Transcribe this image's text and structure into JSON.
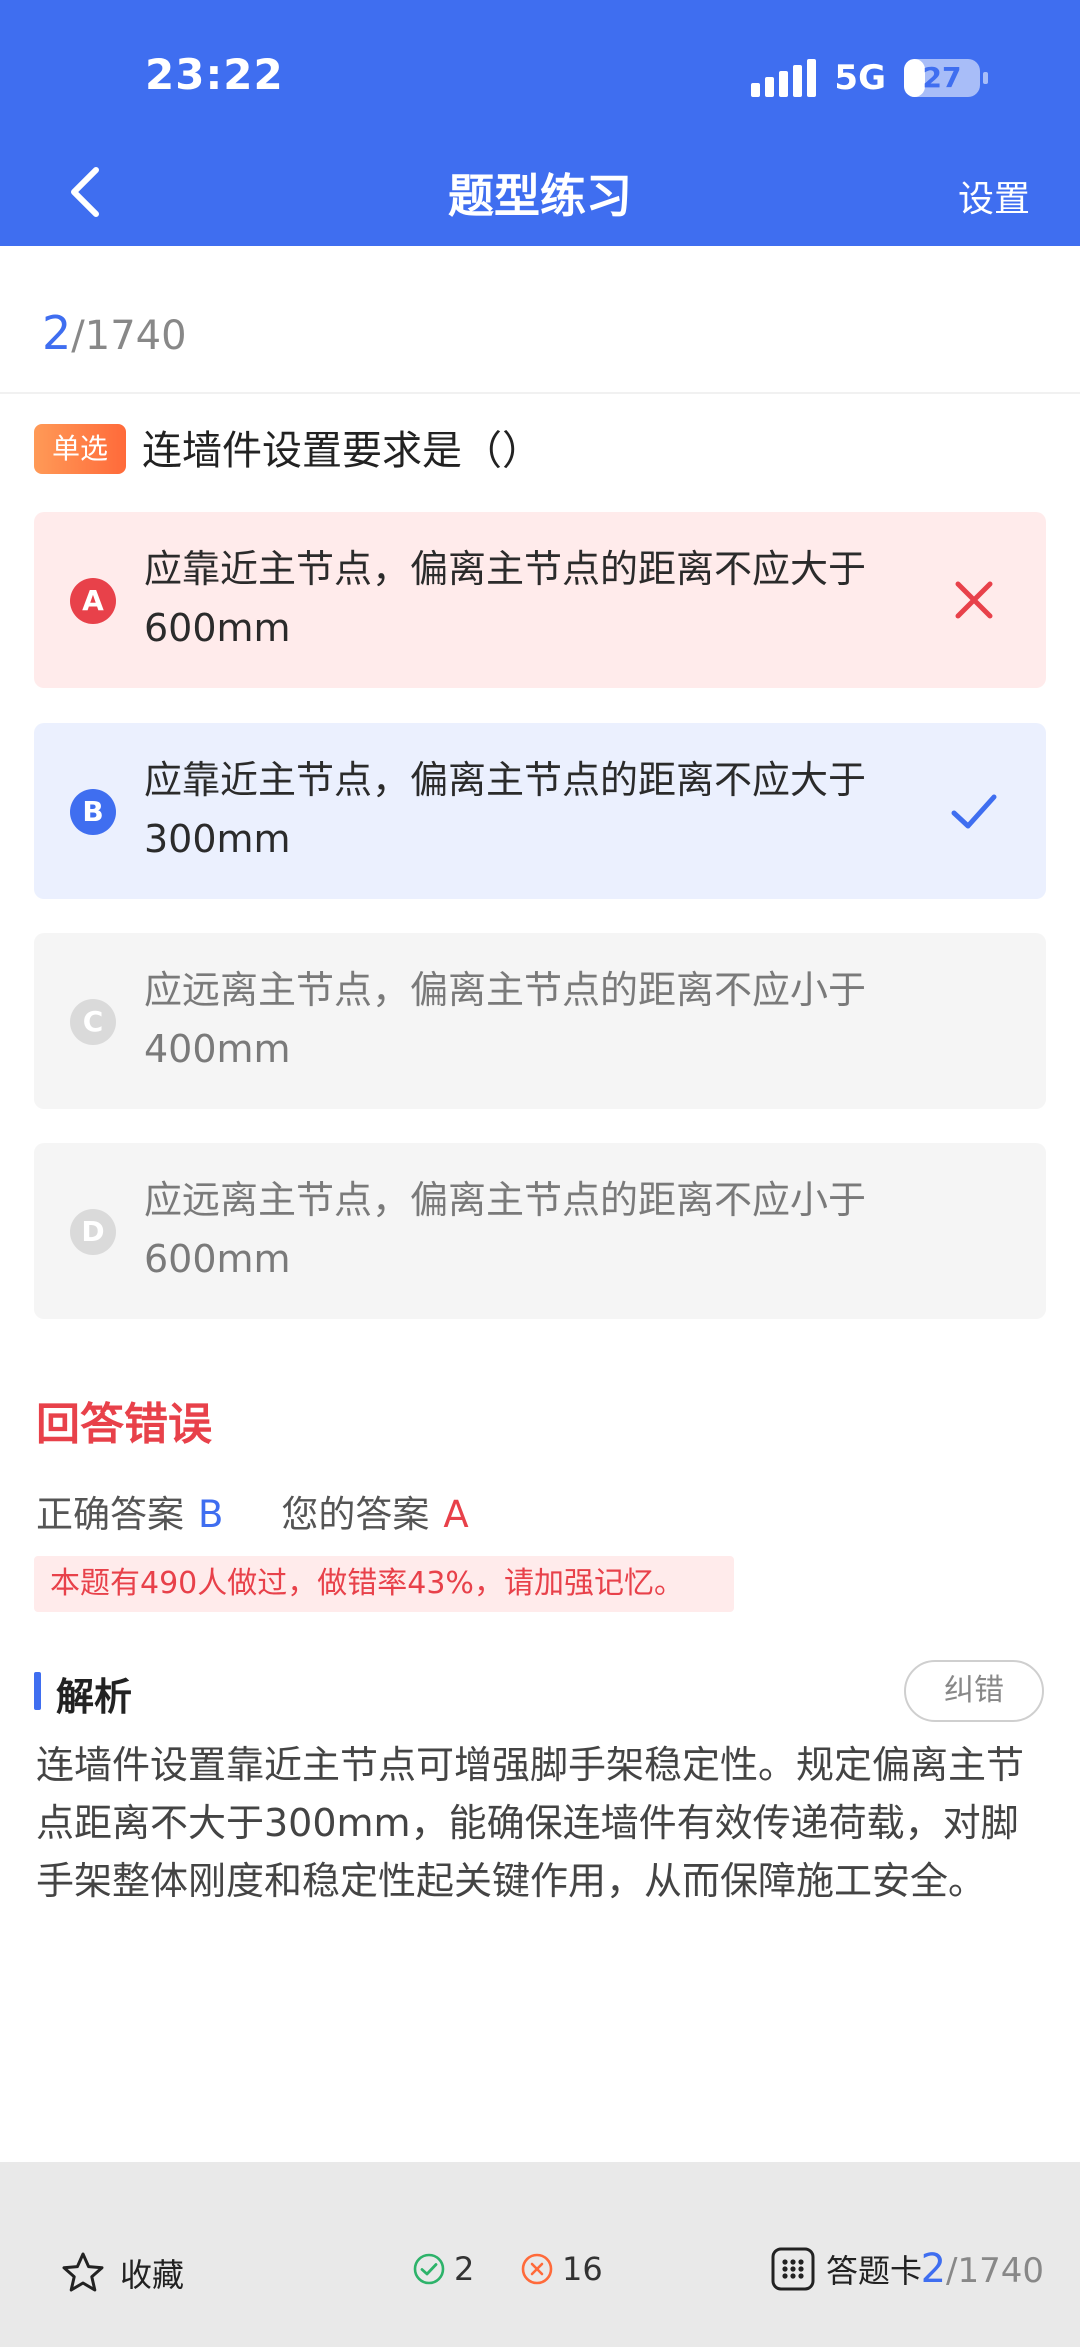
{
  "status": {
    "time": "23:22",
    "network": "5G",
    "battery": "27",
    "battery_level_percent": 27
  },
  "nav": {
    "title": "题型练习",
    "setting_label": "设置"
  },
  "progress": {
    "current": "2",
    "total": "/1740"
  },
  "question": {
    "type_label": "单选",
    "text": "连墙件设置要求是（）",
    "options": [
      {
        "letter": "A",
        "text": "应靠近主节点，偏离主节点的距离不应大于600mm",
        "state": "wrong"
      },
      {
        "letter": "B",
        "text": "应靠近主节点，偏离主节点的距离不应大于300mm",
        "state": "correct"
      },
      {
        "letter": "C",
        "text": "应远离主节点，偏离主节点的距离不应小于400mm",
        "state": "plain"
      },
      {
        "letter": "D",
        "text": "应远离主节点，偏离主节点的距离不应小于600mm",
        "state": "plain"
      }
    ]
  },
  "result": {
    "title": "回答错误",
    "correct_label": "正确答案",
    "correct_answer": "B",
    "your_label": "您的答案",
    "your_answer": "A",
    "stat_text": "本题有490人做过，做错率43%，请加强记忆。"
  },
  "analysis": {
    "title": "解析",
    "report_button": "纠错",
    "text": "连墙件设置靠近主节点可增强脚手架稳定性。规定偏离主节点距离不大于300mm，能确保连墙件有效传递荷载，对脚手架整体刚度和稳定性起关键作用，从而保障施工安全。"
  },
  "bottom": {
    "favorite_label": "收藏",
    "correct_count": "2",
    "wrong_count": "16",
    "answer_card_label": "答题卡",
    "progress_current": "2",
    "progress_total": "/1740"
  },
  "colors": {
    "primary": "#3F6EF0",
    "error": "#E8414A",
    "success": "#2DB36A",
    "warning": "#FF6A3A"
  },
  "icons": {
    "back": "chevron-left-icon",
    "wrong_mark": "close-icon",
    "right_mark": "check-icon",
    "favorite": "star-outline-icon",
    "correct_count": "check-circle-icon",
    "wrong_count": "x-circle-icon",
    "answer_card": "grid-icon"
  }
}
